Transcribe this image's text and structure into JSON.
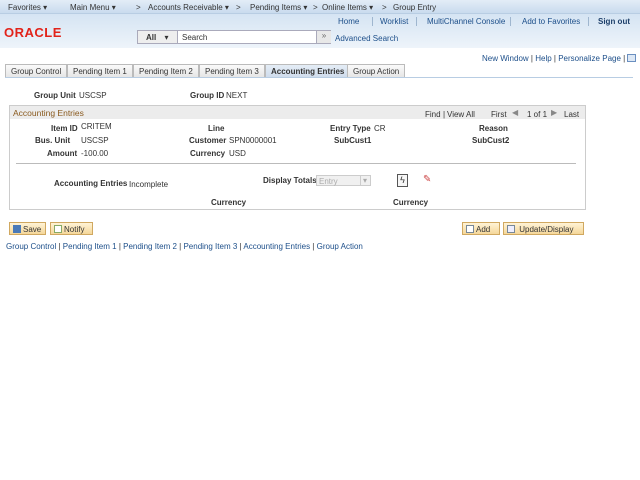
{
  "nav": {
    "items": [
      "Favorites ▾",
      "Main Menu ▾",
      ">",
      "Accounts Receivable ▾",
      ">",
      "Pending Items ▾",
      ">",
      "Online Items ▾",
      ">",
      "Group Entry"
    ]
  },
  "header": {
    "links": [
      "Home",
      "Worklist",
      "MultiChannel Console",
      "Add to Favorites"
    ],
    "signout": "Sign out",
    "logo": "ORACLE",
    "search_scope": "All",
    "search_placeholder": "Search",
    "advanced": "Advanced Search"
  },
  "toolbar": {
    "new_window": "New Window",
    "help": "Help",
    "personalize": "Personalize Page"
  },
  "tabs": [
    {
      "label": "Group Control"
    },
    {
      "label": "Pending Item 1"
    },
    {
      "label": "Pending Item 2"
    },
    {
      "label": "Pending Item 3"
    },
    {
      "label": "Accounting Entries",
      "active": true
    },
    {
      "label": "Group Action"
    }
  ],
  "form": {
    "group_unit_label": "Group Unit",
    "group_unit": "USCSP",
    "group_id_label": "Group ID",
    "group_id": "NEXT"
  },
  "grid": {
    "title": "Accounting Entries",
    "find": "Find",
    "view_all": "View All",
    "first": "First",
    "count": "1 of 1",
    "last": "Last",
    "item_id_label": "Item ID",
    "item_id": "CRITEM",
    "line_label": "Line",
    "entry_type_label": "Entry Type",
    "entry_type": "CR",
    "reason_label": "Reason",
    "bus_unit_label": "Bus. Unit",
    "bus_unit": "USCSP",
    "customer_label": "Customer",
    "customer": "SPN0000001",
    "subcust1_label": "SubCust1",
    "subcust2_label": "SubCust2",
    "amount_label": "Amount",
    "amount": "-100.00",
    "currency_label": "Currency",
    "currency": "USD",
    "acct_entries_label": "Accounting Entries",
    "acct_entries_status": "Incomplete",
    "display_totals_label": "Display Totals",
    "display_totals_value": "Entry",
    "currency_col1": "Currency",
    "currency_col2": "Currency"
  },
  "buttons": {
    "save": "Save",
    "notify": "Notify",
    "add": "Add",
    "update": "Update/Display"
  },
  "footer_links": [
    "Group Control",
    "Pending Item 1",
    "Pending Item 2",
    "Pending Item 3",
    "Accounting Entries",
    "Group Action"
  ]
}
